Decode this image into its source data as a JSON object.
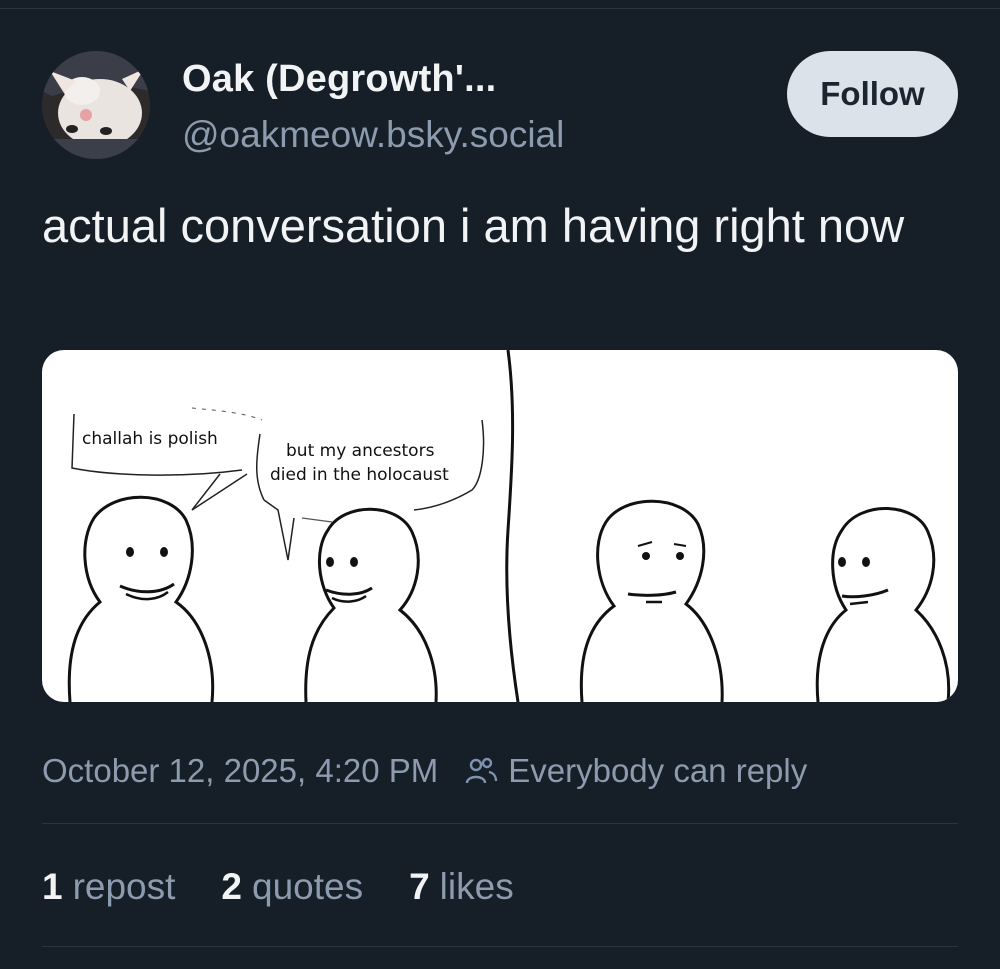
{
  "post": {
    "author": {
      "display_name": "Oak (Degrowth'...",
      "handle": "@oakmeow.bsky.social"
    },
    "follow_label": "Follow",
    "text": "actual conversation i am having right now",
    "image": {
      "bubble_1": "challah is polish",
      "bubble_2_line1": "but my ancestors",
      "bubble_2_line2": "died in the holocaust"
    },
    "timestamp": "October 12, 2025, 4:20 PM",
    "reply_setting": "Everybody can reply",
    "reply_setting_icon": "people-icon",
    "stats": {
      "reposts_count": "1",
      "reposts_label": "repost",
      "quotes_count": "2",
      "quotes_label": "quotes",
      "likes_count": "7",
      "likes_label": "likes"
    }
  },
  "colors": {
    "background": "#161e27",
    "text_primary": "#f1f3f5",
    "text_secondary": "#8c9bad",
    "follow_button_bg": "#dce2ea",
    "divider": "#2a3542"
  }
}
